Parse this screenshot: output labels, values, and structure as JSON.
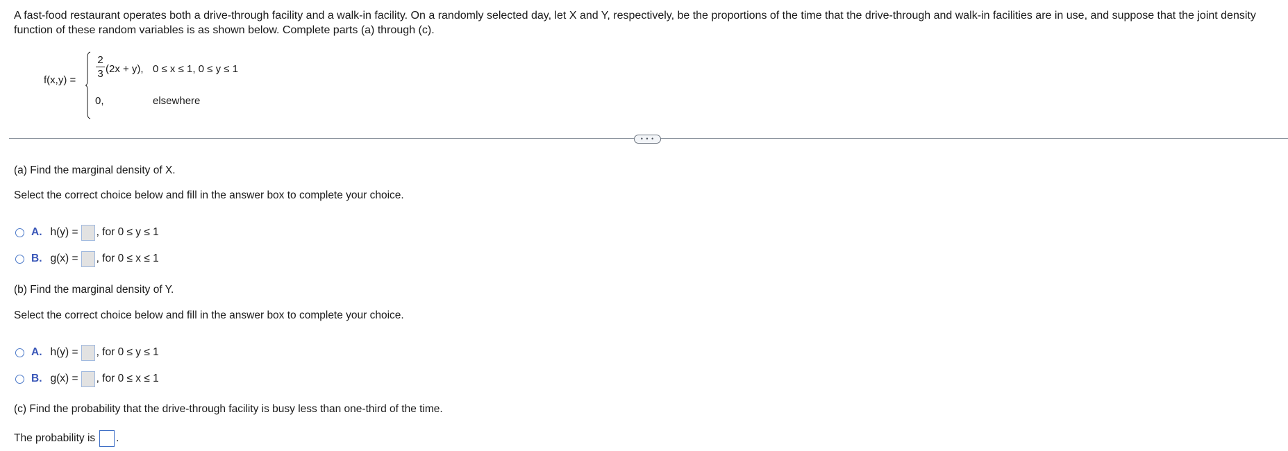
{
  "intro": "A fast-food restaurant operates both a drive-through facility and a walk-in facility. On a randomly selected day, let X and Y, respectively, be the proportions of the time that the drive-through and walk-in facilities are in use, and suppose that the joint density function of these random variables is as shown below. Complete parts (a) through (c).",
  "formula": {
    "label": "f(x,y) =",
    "fraction_numerator": "2",
    "fraction_denominator": "3",
    "expression": "(2x + y),",
    "condition": "0 ≤ x ≤ 1, 0 ≤ y ≤ 1",
    "otherwise_value": "0,",
    "otherwise_condition": "elsewhere"
  },
  "divider": {
    "more_label": "• • •"
  },
  "part_a": {
    "question": "(a) Find the marginal density of X.",
    "instruction": "Select the correct choice below and fill in the answer box to complete your choice.",
    "options": [
      {
        "letter": "A.",
        "lhs": "h(y) =",
        "answer": "",
        "range": ", for 0 ≤ y ≤ 1"
      },
      {
        "letter": "B.",
        "lhs": "g(x) =",
        "answer": "",
        "range": ", for 0 ≤ x ≤ 1"
      }
    ]
  },
  "part_b": {
    "question": "(b) Find the marginal density of Y.",
    "instruction": "Select the correct choice below and fill in the answer box to complete your choice.",
    "options": [
      {
        "letter": "A.",
        "lhs": "h(y) =",
        "answer": "",
        "range": ", for 0 ≤ y ≤ 1"
      },
      {
        "letter": "B.",
        "lhs": "g(x) =",
        "answer": "",
        "range": ", for 0 ≤ x ≤ 1"
      }
    ]
  },
  "part_c": {
    "question": "(c) Find the probability that the drive-through facility is busy less than one-third of the time.",
    "answer_prefix": "The probability is",
    "answer": "",
    "answer_suffix": "."
  }
}
